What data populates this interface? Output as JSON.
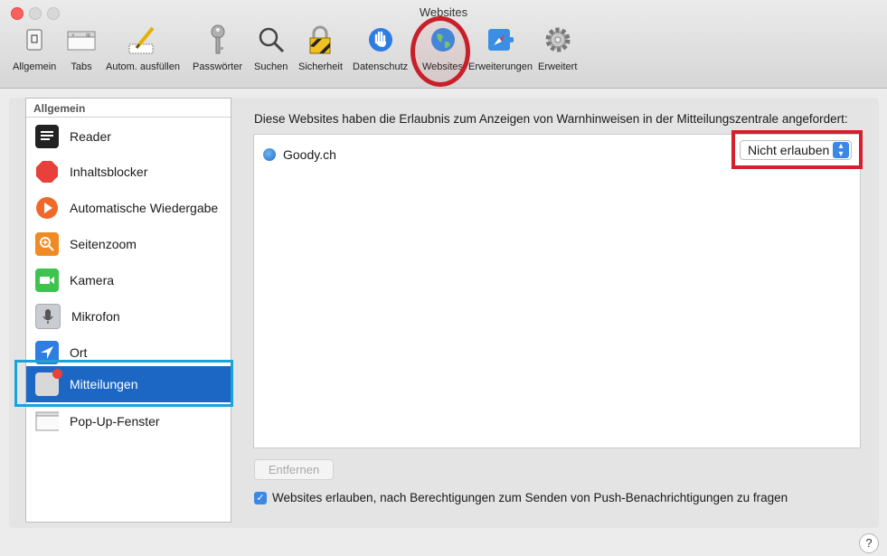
{
  "window": {
    "title": "Websites"
  },
  "toolbar": {
    "items": [
      {
        "label": "Allgemein",
        "icon": "switch-icon"
      },
      {
        "label": "Tabs",
        "icon": "tabs-icon"
      },
      {
        "label": "Autom. ausfüllen",
        "icon": "pencil-icon"
      },
      {
        "label": "Passwörter",
        "icon": "key-icon"
      },
      {
        "label": "Suchen",
        "icon": "magnifier-icon"
      },
      {
        "label": "Sicherheit",
        "icon": "lock-icon"
      },
      {
        "label": "Datenschutz",
        "icon": "hand-icon"
      },
      {
        "label": "Websites",
        "icon": "globe-icon"
      },
      {
        "label": "Erweiterungen",
        "icon": "extensions-icon"
      },
      {
        "label": "Erweitert",
        "icon": "gear-icon"
      }
    ]
  },
  "sidebar": {
    "header": "Allgemein",
    "items": [
      {
        "label": "Reader",
        "icon": "reader-icon"
      },
      {
        "label": "Inhaltsblocker",
        "icon": "stop-icon"
      },
      {
        "label": "Automatische Wiedergabe",
        "icon": "play-icon"
      },
      {
        "label": "Seitenzoom",
        "icon": "zoom-icon"
      },
      {
        "label": "Kamera",
        "icon": "camera-icon"
      },
      {
        "label": "Mikrofon",
        "icon": "microphone-icon"
      },
      {
        "label": "Ort",
        "icon": "location-icon"
      },
      {
        "label": "Mitteilungen",
        "icon": "notifications-icon",
        "selected": true
      },
      {
        "label": "Pop-Up-Fenster",
        "icon": "popup-window-icon"
      }
    ]
  },
  "main": {
    "description": "Diese Websites haben die Erlaubnis zum Anzeigen von Warnhinweisen in der Mitteilungszentrale angefordert:",
    "sites": [
      {
        "name": "Goody.ch",
        "permission": "Nicht erlauben"
      }
    ],
    "remove_label": "Entfernen",
    "checkbox_label": "Websites erlauben, nach Berechtigungen zum Senden von Push-Benachrichtigungen zu fragen",
    "checkbox_checked": true
  },
  "help": {
    "label": "?"
  }
}
